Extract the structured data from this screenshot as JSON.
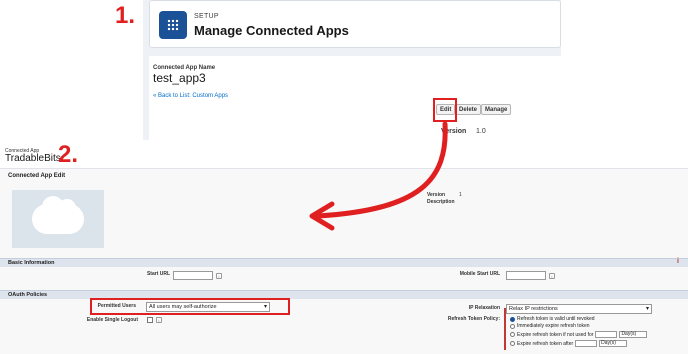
{
  "steps": {
    "one": "1.",
    "two": "2."
  },
  "top": {
    "setup_label": "SETUP",
    "title": "Manage Connected Apps",
    "app_name_label": "Connected App Name",
    "app_name": "test_app3",
    "back_link": "« Back to List: Custom Apps",
    "buttons": {
      "edit": "Edit",
      "delete": "Delete",
      "manage": "Manage"
    },
    "version_label": "Version",
    "version_value": "1.0"
  },
  "bottom": {
    "conn_app_label": "Connected App",
    "conn_app_name": "TradableBits",
    "edit_header": "Connected App Edit",
    "version_label": "Version",
    "version_value": "1",
    "description_label": "Description",
    "basic_info": "Basic Information",
    "start_url_label": "Start URL",
    "mobile_start_url_label": "Mobile Start URL",
    "oauth_policies": "OAuth Policies",
    "permitted_users_label": "Permitted Users",
    "permitted_users_value": "All users may self-authorize",
    "single_logout_label": "Enable Single Logout",
    "ip_relaxation_label": "IP Relaxation",
    "ip_relaxation_value": "Relax IP restrictions",
    "refresh_policy_label": "Refresh Token Policy:",
    "refresh_options": [
      "Refresh token is valid until revoked",
      "Immediately expire refresh token",
      "Expire refresh token if not used for",
      "Expire refresh token after"
    ],
    "day_unit": "Day(s)",
    "info_icon": "i",
    "required_mark": "i"
  },
  "colors": {
    "accent": "#e02020",
    "brand": "#1b5297"
  }
}
